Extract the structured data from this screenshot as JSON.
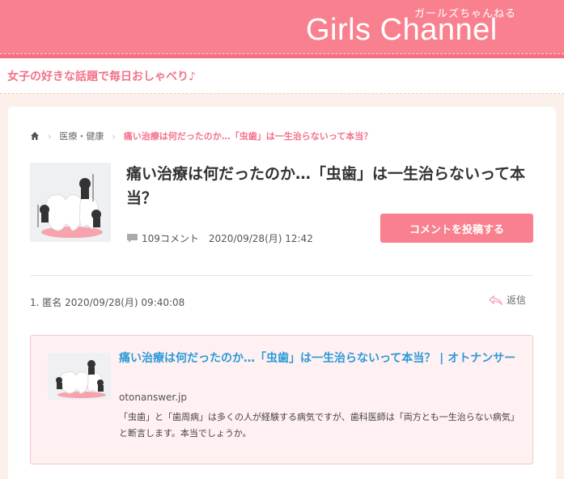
{
  "header": {
    "logo_text": "Girls Channel",
    "logo_sub": "ガールズちゃんねる",
    "tagline": "女子の好きな話題で毎日おしゃべり♪"
  },
  "breadcrumb": {
    "home_icon": "home-icon",
    "category": "医療・健康",
    "current": "痛い治療は何だったのか…「虫歯」は一生治らないって本当？"
  },
  "topic": {
    "title": "痛い治療は何だったのか…「虫歯」は一生治らないって本当？",
    "comment_count": "109コメント",
    "date": "2020/09/28(月) 12:42",
    "post_button": "コメントを投稿する"
  },
  "comment": {
    "header": "1. 匿名 2020/09/28(月) 09:40:08",
    "reply_label": "返信",
    "link_card": {
      "title": "痛い治療は何だったのか…「虫歯」は一生治らないって本当？ | オトナンサー",
      "domain": "otonanswer.jp",
      "description": "「虫歯」と「歯周病」は多くの人が経験する病気ですが、歯科医師は「両方とも一生治らない病気」と断言します。本当でしょうか。"
    }
  },
  "colors": {
    "brand_pink": "#f9818f",
    "accent_pink": "#f4728a",
    "link_blue": "#2a9ad8",
    "page_bg": "#fbf1ea",
    "card_bg": "#fff0f1"
  }
}
